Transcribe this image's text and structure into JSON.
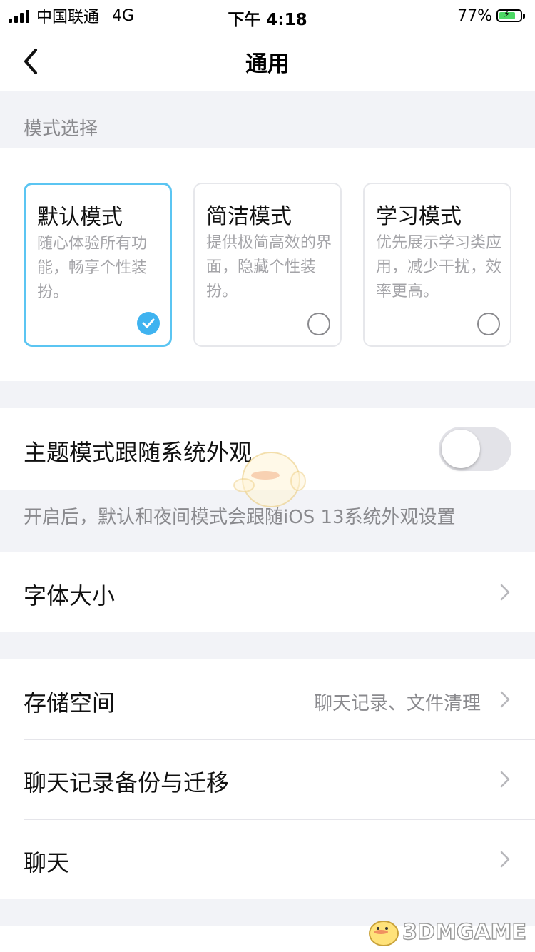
{
  "status_bar": {
    "carrier": "中国联通",
    "network": "4G",
    "time": "下午 4:18",
    "battery": "77%",
    "battery_level": 0.77
  },
  "nav": {
    "title": "通用",
    "back_icon": "chevron-left-icon"
  },
  "mode_section": {
    "label": "模式选择",
    "modes": [
      {
        "title": "默认模式",
        "desc": "随心体验所有功能，畅享个性装扮。",
        "selected": true
      },
      {
        "title": "简洁模式",
        "desc": "提供极简高效的界面，隐藏个性装扮。",
        "selected": false
      },
      {
        "title": "学习模式",
        "desc": "优先展示学习类应用，减少干扰，效率更高。",
        "selected": false
      }
    ]
  },
  "theme_follow": {
    "label": "主题模式跟随系统外观",
    "enabled": false,
    "hint": "开启后，默认和夜间模式会跟随iOS 13系统外观设置"
  },
  "font_size": {
    "label": "字体大小"
  },
  "storage": {
    "label": "存储空间",
    "value": "聊天记录、文件清理"
  },
  "chat_backup": {
    "label": "聊天记录备份与迁移"
  },
  "chat": {
    "label": "聊天"
  },
  "watermark": {
    "text": "3DMGAME"
  },
  "colors": {
    "accent": "#3fb3f0",
    "selected_border": "#5bc5f2",
    "background": "#f2f3f7",
    "battery_fill": "#4cd964"
  }
}
